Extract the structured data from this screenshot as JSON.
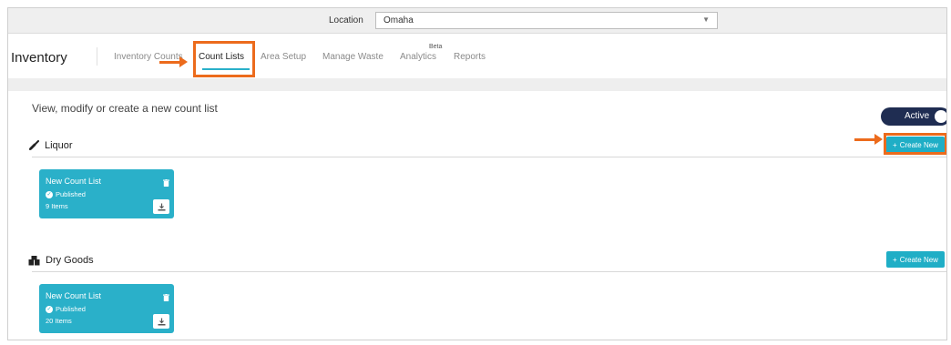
{
  "location_bar": {
    "label": "Location",
    "selected": "Omaha"
  },
  "nav": {
    "brand": "Inventory",
    "tabs": [
      {
        "label": "Inventory Counts"
      },
      {
        "label": "Count Lists"
      },
      {
        "label": "Area Setup"
      },
      {
        "label": "Manage Waste"
      },
      {
        "label": "Analytics",
        "badge": "Beta"
      },
      {
        "label": "Reports"
      }
    ]
  },
  "intro": "View, modify or create a new count list",
  "toggle": {
    "label": "Active"
  },
  "colors": {
    "accent": "#2ab0c9",
    "highlight": "#ec6b1c",
    "toggle": "#1f2d52"
  },
  "sections": [
    {
      "title": "Liquor",
      "icon": "bottle-icon",
      "create_label": "Create New",
      "cards": [
        {
          "title": "New Count List",
          "status": "Published",
          "items": "9 Items"
        }
      ]
    },
    {
      "title": "Dry Goods",
      "icon": "boxes-icon",
      "create_label": "Create New",
      "cards": [
        {
          "title": "New Count List",
          "status": "Published",
          "items": "20 Items"
        }
      ]
    }
  ]
}
